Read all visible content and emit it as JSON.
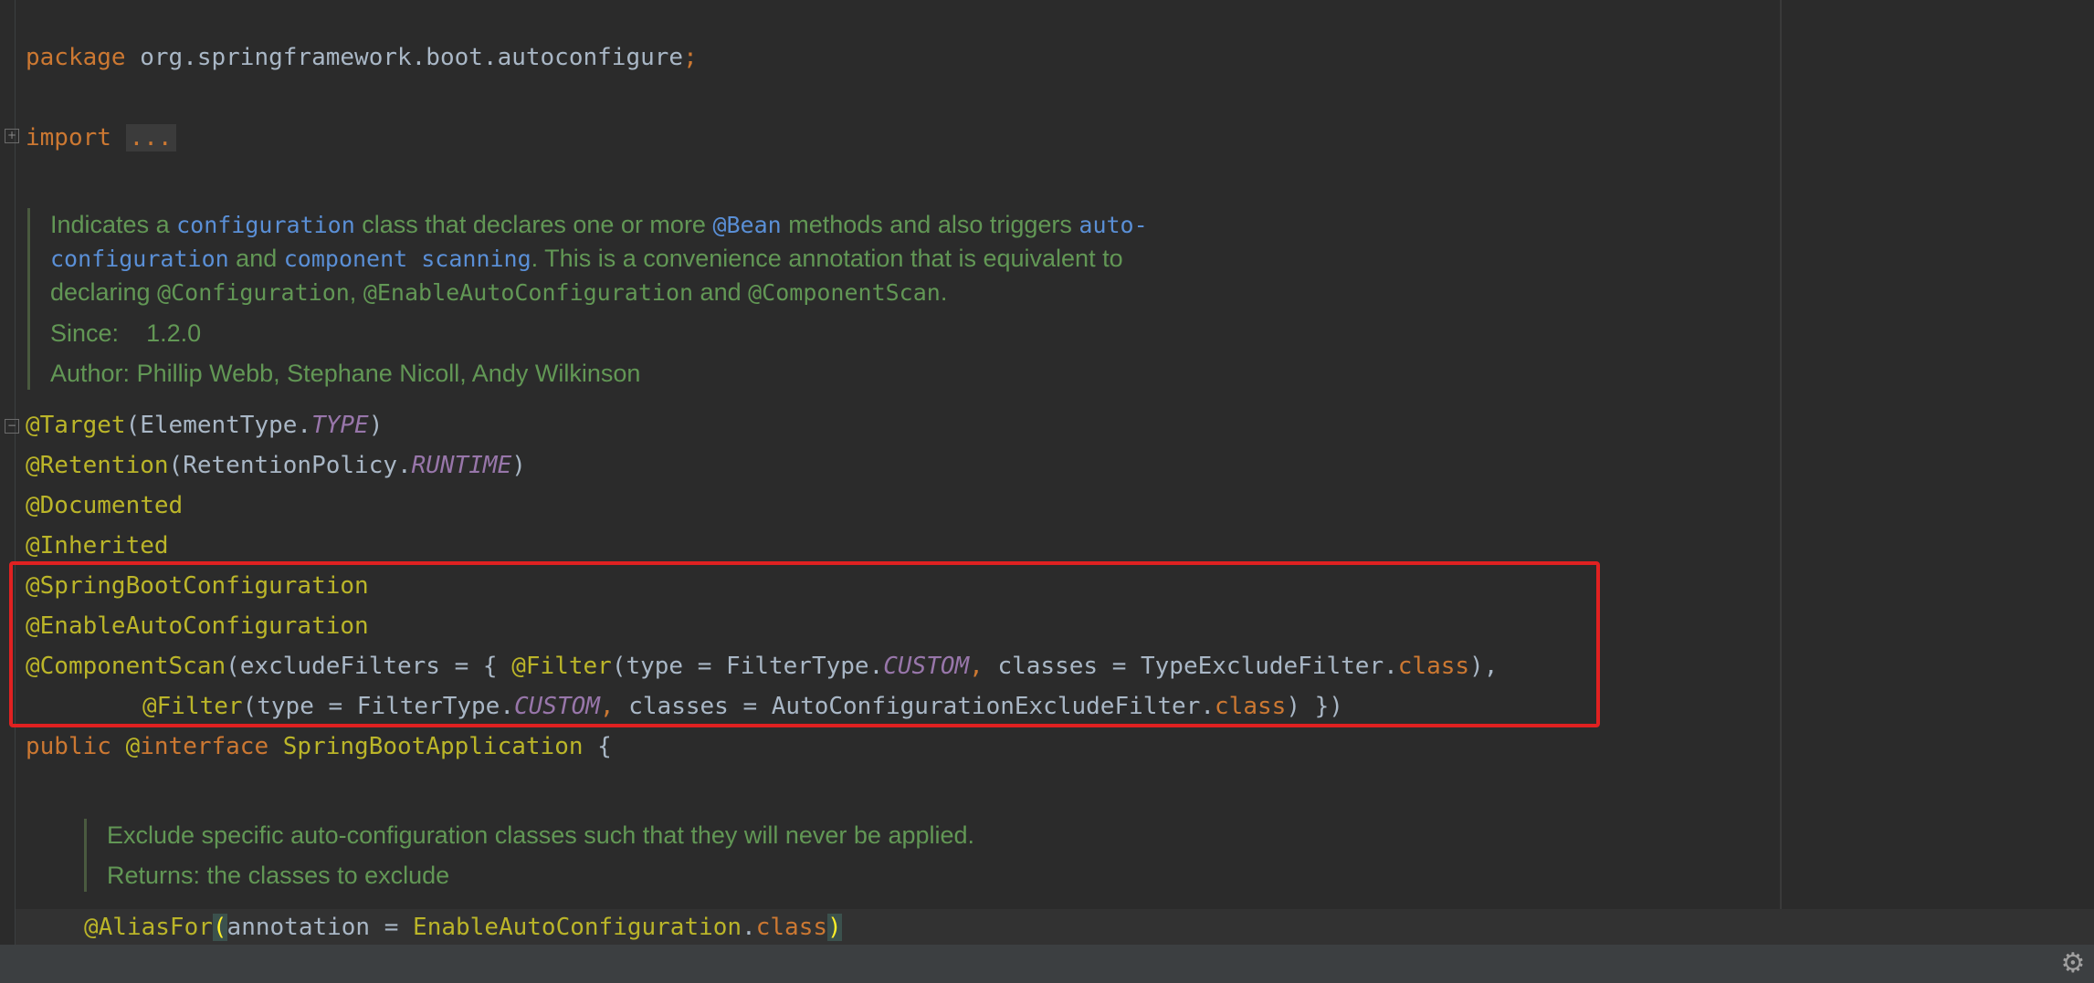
{
  "code": {
    "package_kw": "package",
    "package_name": "org.springframework.boot.autoconfigure",
    "semicolon": ";",
    "import_kw": "import",
    "import_fold": "...",
    "ann_target": "@Target",
    "target_args_open": "(ElementType.",
    "target_const": "TYPE",
    "paren_close": ")",
    "ann_retention": "@Retention",
    "retention_args_open": "(RetentionPolicy.",
    "retention_const": "RUNTIME",
    "ann_documented": "@Documented",
    "ann_inherited": "@Inherited",
    "ann_sbc": "@SpringBootConfiguration",
    "ann_eac": "@EnableAutoConfiguration",
    "ann_cs": "@ComponentScan",
    "cs_args": "(excludeFilters = { ",
    "ann_filter": "@Filter",
    "filter_args": "(type = FilterType.",
    "custom_const": "CUSTOM",
    "comma": ",",
    "classes_tef": " classes = TypeExcludeFilter.",
    "class_kw": "class",
    "close_comma": "),",
    "classes_acef": " classes = AutoConfigurationExcludeFilter.",
    "close_end": ") })",
    "public_kw": "public",
    "at_sign": "@",
    "interface_kw": "interface",
    "class_name": "SpringBootApplication",
    "open_brace": " {",
    "ann_alias": "@AliasFor",
    "paren_open": "(",
    "alias_args": "annotation = ",
    "alias_class": "EnableAutoConfiguration",
    "dot": "."
  },
  "doc1": {
    "t1": "Indicates a ",
    "link_configuration": "configuration",
    "t2": " class that declares one or more ",
    "link_bean": "@Bean",
    "t3": " methods and also triggers ",
    "link_auto_1": "auto-",
    "link_auto_2": "configuration",
    "t4": " and ",
    "link_component": "component scanning",
    "t5": ". This is a convenience annotation that is equivalent to",
    "t6": "declaring ",
    "mono_configuration": "@Configuration",
    "sep1": ", ",
    "mono_eac": "@EnableAutoConfiguration",
    "t7": " and ",
    "mono_cs": "@ComponentScan",
    "t8": ".",
    "since_label": "Since:",
    "since_value": "1.2.0",
    "author_label": "Author:",
    "author_value": "Phillip Webb, Stephane Nicoll, Andy Wilkinson"
  },
  "doc2": {
    "line1": "Exclude specific auto-configuration classes such that they will never be applied.",
    "line2": "Returns: the classes to exclude"
  },
  "icons": {
    "fold_plus": "fold-expand-icon",
    "fold_minus": "fold-collapse-icon",
    "settings": "gear-icon"
  },
  "colors": {
    "background": "#2b2b2b",
    "keyword": "#cc7832",
    "annotation": "#bbb529",
    "constant": "#9876aa",
    "doc_text": "#629755",
    "doc_link": "#5a8fd6",
    "highlight_box": "#e02121"
  }
}
